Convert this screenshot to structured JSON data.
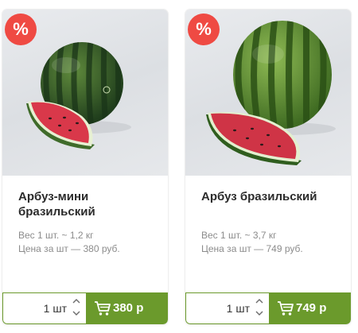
{
  "products": [
    {
      "badge": "%",
      "title_line1": "Арбуз-мини",
      "title_line2": "бразильский",
      "weight": "Вес 1 шт. ~ 1,2 кг",
      "price_per_unit": "Цена за шт — 380 руб.",
      "quantity": "1 шт",
      "cart_price": "380 р"
    },
    {
      "badge": "%",
      "title_line1": "Арбуз бразильский",
      "title_line2": "",
      "weight": "Вес 1 шт. ~ 3,7 кг",
      "price_per_unit": "Цена за шт — 749 руб.",
      "quantity": "1 шт",
      "cart_price": "749 р"
    }
  ],
  "icons": {
    "sale": "percent-badge-icon",
    "increment": "chevron-up-icon",
    "decrement": "chevron-down-icon",
    "cart": "cart-icon"
  },
  "colors": {
    "accent_green": "#6b9a2c",
    "sale_red": "#ef4a43",
    "title_text": "#2b2b2b",
    "muted_text": "#8c8c8c"
  }
}
